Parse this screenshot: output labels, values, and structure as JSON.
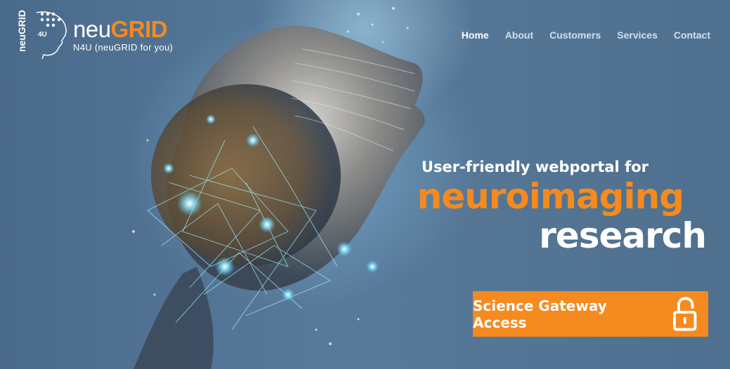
{
  "brand": {
    "name_prefix": "neu",
    "name_suffix": "GRID",
    "subtitle": "N4U (neuGRID for you)",
    "logo_text_main": "neuGRID",
    "logo_text_small": "4U",
    "accent_color": "#f58a1f"
  },
  "nav": {
    "items": [
      {
        "label": "Home",
        "active": true
      },
      {
        "label": "About",
        "active": false
      },
      {
        "label": "Customers",
        "active": false
      },
      {
        "label": "Services",
        "active": false
      },
      {
        "label": "Contact",
        "active": false
      }
    ]
  },
  "hero": {
    "line1": "User-friendly webportal for",
    "line2": "neuroimaging",
    "line3": "research",
    "illustration": "digital-head-icon"
  },
  "cta": {
    "label": "Science Gateway Access",
    "icon": "unlocked-padlock-icon"
  }
}
